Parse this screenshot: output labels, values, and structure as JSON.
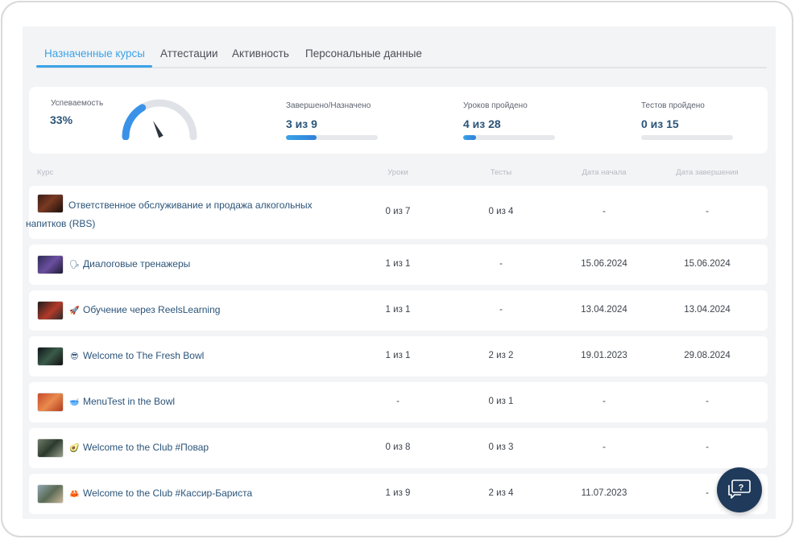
{
  "tabs": [
    {
      "label": "Назначенные курсы",
      "active": true
    },
    {
      "label": "Аттестации",
      "active": false
    },
    {
      "label": "Активность",
      "active": false
    },
    {
      "label": "Персональные данные",
      "active": false
    }
  ],
  "stats": {
    "success": {
      "label": "Успеваемость",
      "value": "33%",
      "percent": 33
    },
    "completed": {
      "label": "Завершено/Назначено",
      "value": "3 из 9",
      "progress": 0.33
    },
    "lessons": {
      "label": "Уроков пройдено",
      "value": "4 из 28",
      "progress": 0.14
    },
    "tests": {
      "label": "Тестов пройдено",
      "value": "0 из 15",
      "progress": 0
    }
  },
  "table": {
    "headers": {
      "course": "Курс",
      "lessons": "Уроки",
      "tests": "Тесты",
      "start": "Дата начала",
      "end": "Дата завершения"
    },
    "rows": [
      {
        "emoji": "",
        "name": "Ответственное обслуживание и продажа алкогольных напитков (RBS)",
        "lessons": "0 из 7",
        "tests": "0 из 4",
        "start": "-",
        "end": "-"
      },
      {
        "emoji": "🗣",
        "name": "Диалоговые тренажеры",
        "lessons": "1 из 1",
        "tests": "-",
        "start": "15.06.2024",
        "end": "15.06.2024"
      },
      {
        "emoji": "🚀",
        "name": "Обучение через ReelsLearning",
        "lessons": "1 из 1",
        "tests": "-",
        "start": "13.04.2024",
        "end": "13.04.2024"
      },
      {
        "emoji": "😎",
        "name": "Welcome to The Fresh Bowl",
        "lessons": "1 из 1",
        "tests": "2 из 2",
        "start": "19.01.2023",
        "end": "29.08.2024"
      },
      {
        "emoji": "🥣",
        "name": "MenuTest in the Bowl",
        "lessons": "-",
        "tests": "0 из 1",
        "start": "-",
        "end": "-"
      },
      {
        "emoji": "🥑",
        "name": "Welcome to the Club #Повар",
        "lessons": "0 из 8",
        "tests": "0 из 3",
        "start": "-",
        "end": "-"
      },
      {
        "emoji": "🦀",
        "name": "Welcome to the Club #Кассир-Бариста",
        "lessons": "1 из 9",
        "tests": "2 из 4",
        "start": "11.07.2023",
        "end": "-"
      }
    ]
  },
  "colors": {
    "accent": "#3aa3e8",
    "value_text": "#2b5479",
    "chat_button": "#1f3a5a"
  },
  "icons": {
    "chat": "chat-question-icon",
    "gauge": "gauge-icon"
  }
}
